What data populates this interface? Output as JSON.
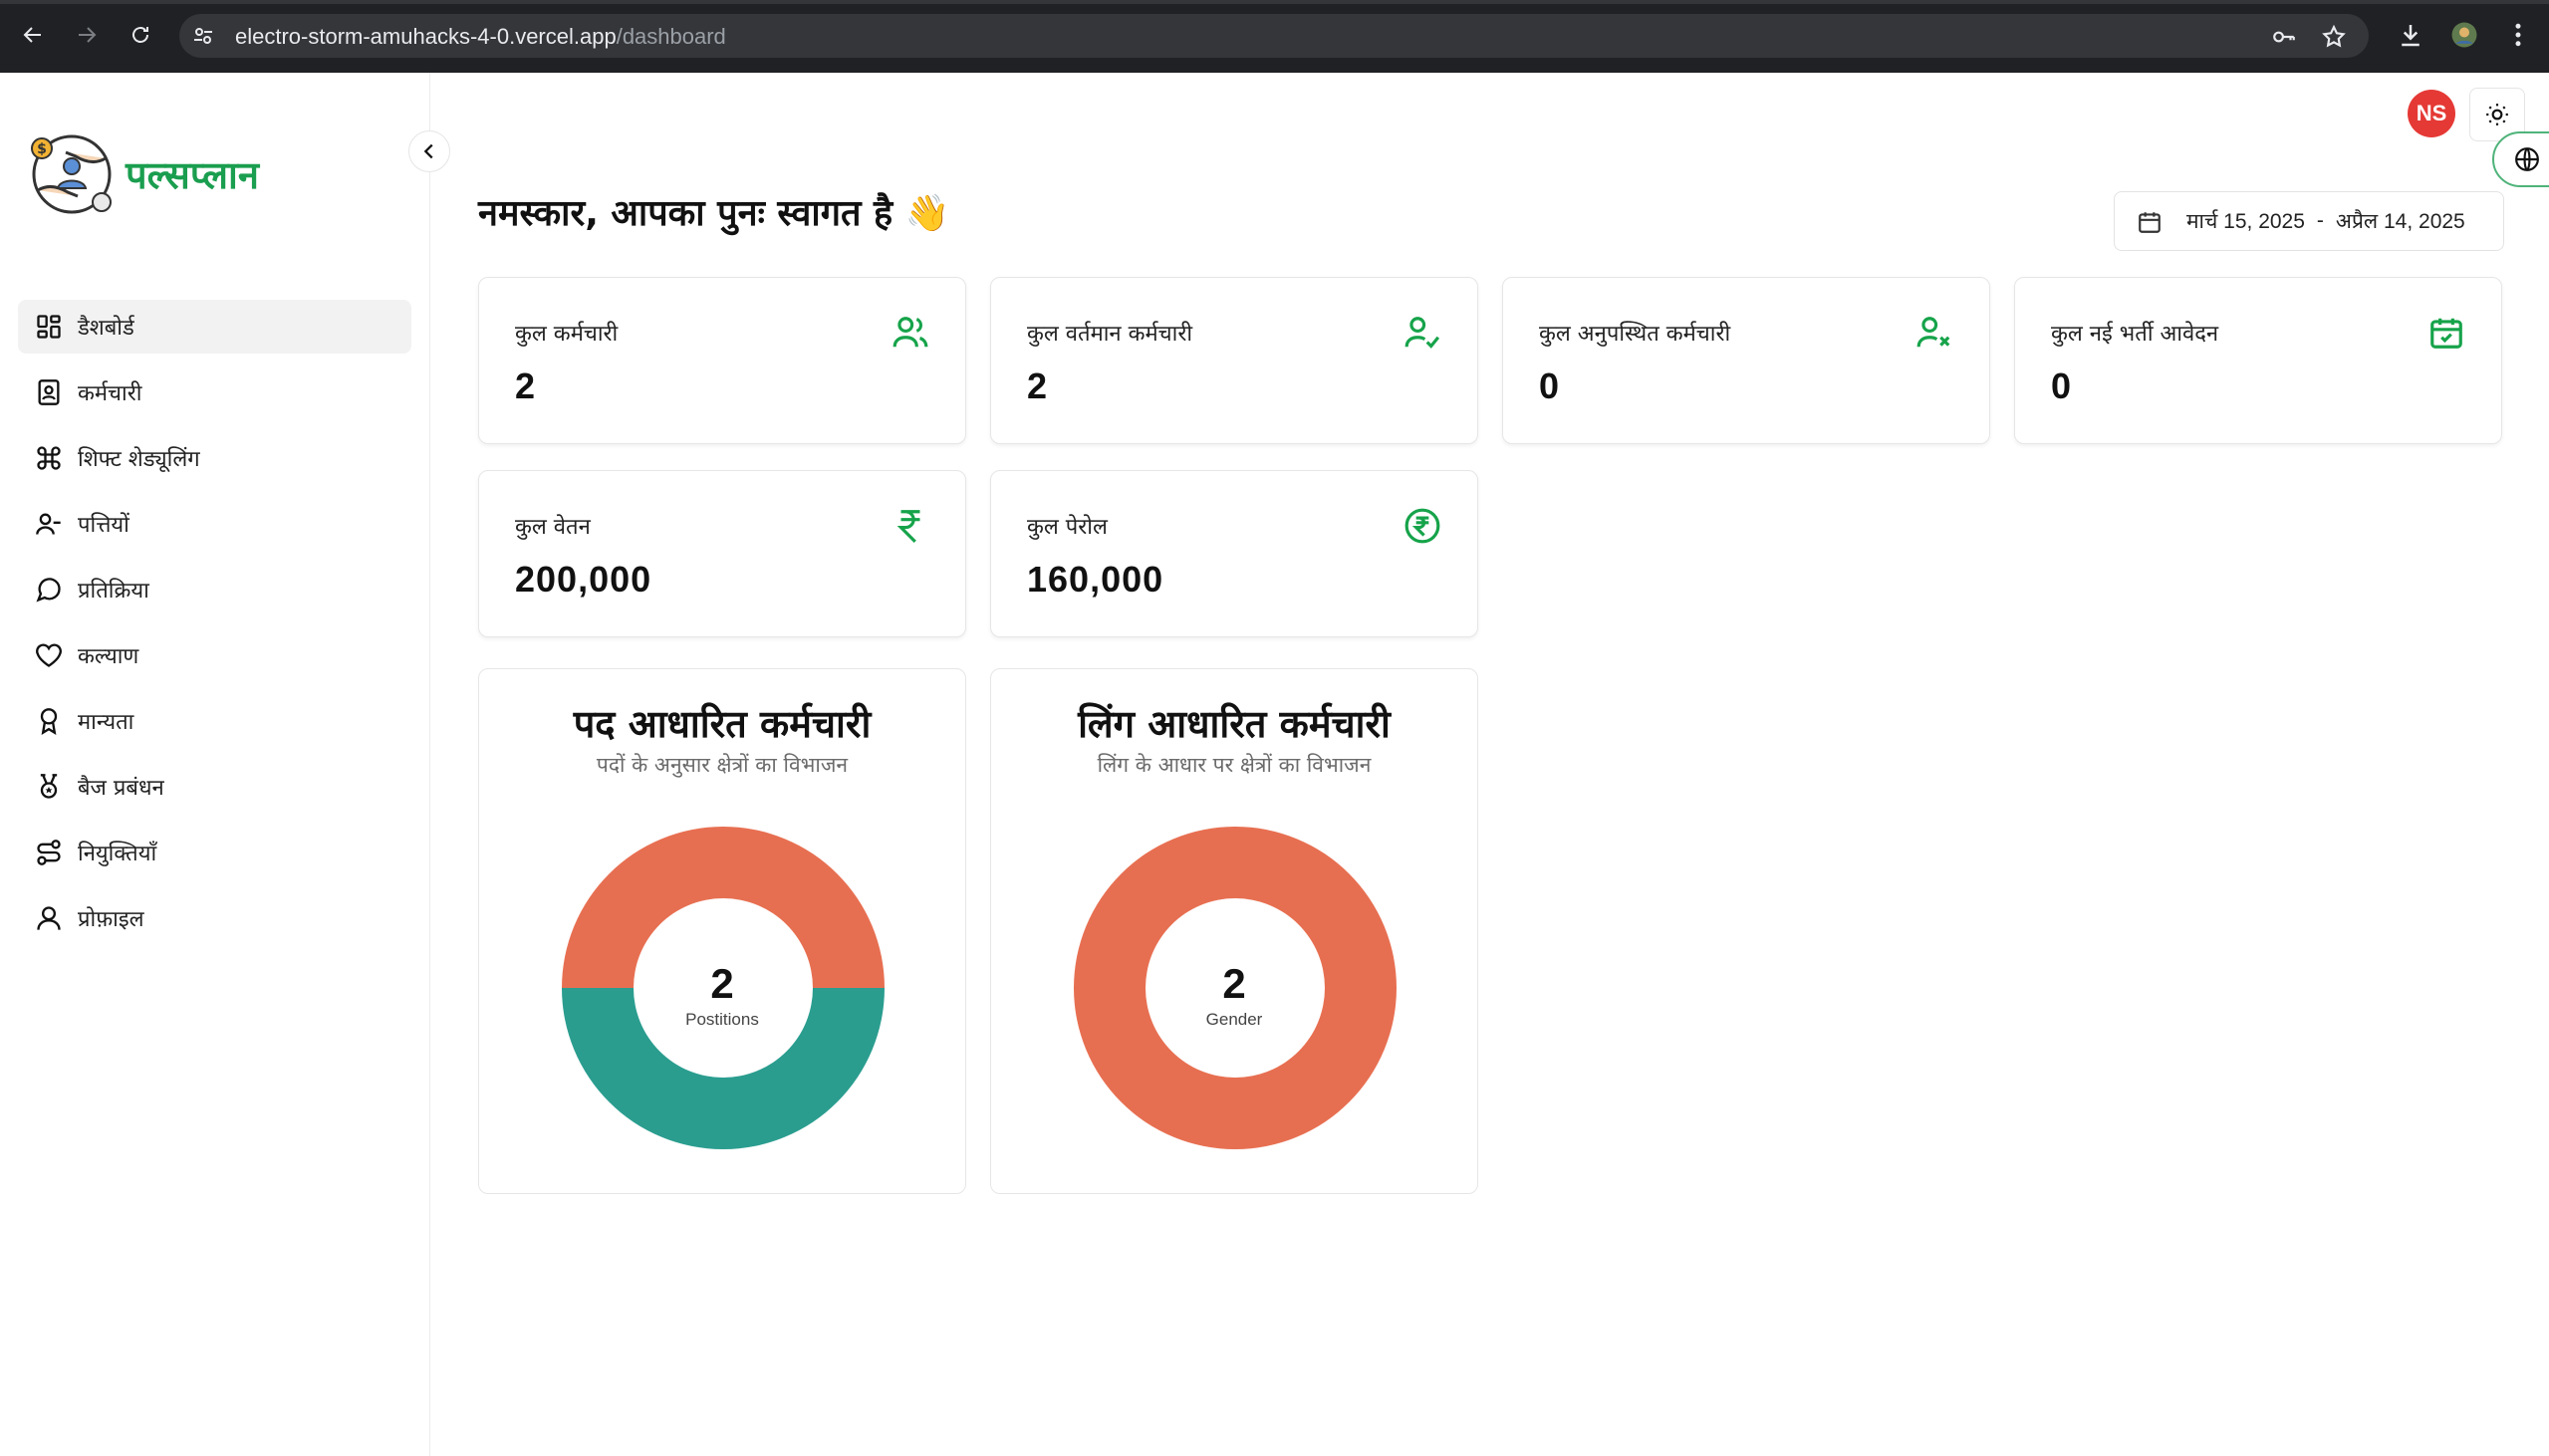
{
  "browser": {
    "url_host": "electro-storm-amuhacks-4-0.vercel.app",
    "url_path": "/dashboard"
  },
  "app": {
    "brand_name": "पल्सप्लान",
    "user_initials": "NS"
  },
  "sidebar": {
    "items": [
      {
        "label": "डैशबोर्ड",
        "icon": "dashboard-grid-icon",
        "active": true
      },
      {
        "label": "कर्मचारी",
        "icon": "contact-card-icon",
        "active": false
      },
      {
        "label": "शिफ्ट शेड्यूलिंग",
        "icon": "command-icon",
        "active": false
      },
      {
        "label": "पत्तियों",
        "icon": "user-minus-icon",
        "active": false
      },
      {
        "label": "प्रतिक्रिया",
        "icon": "message-circle-icon",
        "active": false
      },
      {
        "label": "कल्याण",
        "icon": "heart-icon",
        "active": false
      },
      {
        "label": "मान्यता",
        "icon": "award-icon",
        "active": false
      },
      {
        "label": "बैज प्रबंधन",
        "icon": "medal-icon",
        "active": false
      },
      {
        "label": "नियुक्तियाँ",
        "icon": "route-icon",
        "active": false
      },
      {
        "label": "प्रोफ़ाइल",
        "icon": "user-icon",
        "active": false
      }
    ]
  },
  "main": {
    "greeting": "नमस्कार, आपका पुनः स्वागत है 👋",
    "date_range": {
      "start": "मार्च 15, 2025",
      "separator": "-",
      "end": "अप्रैल 14, 2025"
    },
    "stats": [
      {
        "label": "कुल कर्मचारी",
        "value": "2",
        "icon": "users-icon"
      },
      {
        "label": "कुल वर्तमान कर्मचारी",
        "value": "2",
        "icon": "user-check-icon"
      },
      {
        "label": "कुल अनुपस्थित कर्मचारी",
        "value": "0",
        "icon": "user-x-icon"
      },
      {
        "label": "कुल नई भर्ती आवेदन",
        "value": "0",
        "icon": "calendar-check-icon"
      },
      {
        "label": "कुल वेतन",
        "value": "200,000",
        "icon": "rupee-icon"
      },
      {
        "label": "कुल पेरोल",
        "value": "160,000",
        "icon": "rupee-circle-icon"
      }
    ],
    "charts": [
      {
        "title": "पद आधारित कर्मचारी",
        "subtitle": "पदों के अनुसार क्षेत्रों का विभाजन",
        "center_value": "2",
        "center_label": "Postitions"
      },
      {
        "title": "लिंग आधारित कर्मचारी",
        "subtitle": "लिंग के आधार पर क्षेत्रों का विभाजन",
        "center_value": "2",
        "center_label": "Gender"
      }
    ]
  },
  "colors": {
    "brand_green": "#1a9e4f",
    "icon_green": "#16a34a",
    "chart_orange": "#e76f51",
    "chart_teal": "#2a9d8f",
    "avatar_red": "#e53935"
  },
  "chart_data": [
    {
      "type": "pie",
      "title": "पद आधारित कर्मचारी",
      "subtitle": "पदों के अनुसार क्षेत्रों का विभाजन",
      "total": 2,
      "slices": [
        {
          "value": 1,
          "color": "#e76f51"
        },
        {
          "value": 1,
          "color": "#2a9d8f"
        }
      ]
    },
    {
      "type": "pie",
      "title": "लिंग आधारित कर्मचारी",
      "subtitle": "लिंग के आधार पर क्षेत्रों का विभाजन",
      "total": 2,
      "slices": [
        {
          "value": 2,
          "color": "#e76f51"
        }
      ]
    }
  ]
}
